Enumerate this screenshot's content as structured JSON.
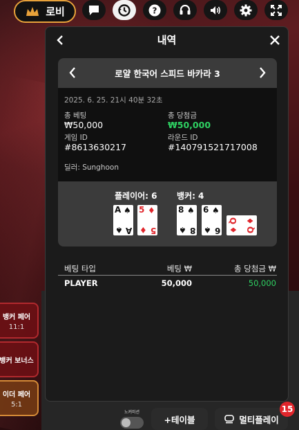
{
  "toolbar": {
    "lobby_label": "로비",
    "icons": [
      "chat-icon",
      "history-icon",
      "help-icon",
      "support-icon",
      "volume-icon",
      "settings-icon",
      "fullscreen-icon"
    ]
  },
  "side_bets": [
    {
      "label": "뱅커 페어",
      "odds": "11:1"
    },
    {
      "label": "뱅커 보너스",
      "odds": ""
    },
    {
      "label": "이더 페어",
      "odds": "5:1"
    }
  ],
  "modal": {
    "title": "내역",
    "game_name": "로얄 한국어 스피드 바카라 3",
    "date": "2025. 6. 25. 21시 40분 32초",
    "total_bet_label": "총 베팅",
    "total_bet_value": "₩50,000",
    "total_win_label": "총 당첨금",
    "total_win_value": "₩50,000",
    "game_id_label": "게임 ID",
    "game_id_value": "#8613630217",
    "round_id_label": "라운드 ID",
    "round_id_value": "#140791521717008",
    "dealer": "딜러: Sunghoon",
    "player_label": "플레이어: 6",
    "banker_label": "뱅커: 4",
    "player_cards": [
      {
        "rank": "A",
        "suit": "♠",
        "color": "black"
      },
      {
        "rank": "5",
        "suit": "♦",
        "color": "red"
      }
    ],
    "banker_cards": [
      {
        "rank": "8",
        "suit": "♠",
        "color": "black"
      },
      {
        "rank": "6",
        "suit": "♠",
        "color": "black"
      },
      {
        "rank": "Q",
        "suit": "♦",
        "color": "red"
      }
    ],
    "bet_table": {
      "headers": [
        "베팅 타입",
        "베팅 ₩",
        "총 당첨금 ₩"
      ],
      "rows": [
        {
          "type": "PLAYER",
          "bet": "50,000",
          "win": "50,000"
        }
      ]
    }
  },
  "bottom": {
    "toggle_label": "노커미션",
    "add_table_label": "+테이블",
    "multiplay_label": "멀티플레이",
    "badge_count": "15"
  },
  "colors": {
    "accent_gold": "#e8a23a",
    "win_green": "#2ed162",
    "card_red": "#e0262c"
  }
}
